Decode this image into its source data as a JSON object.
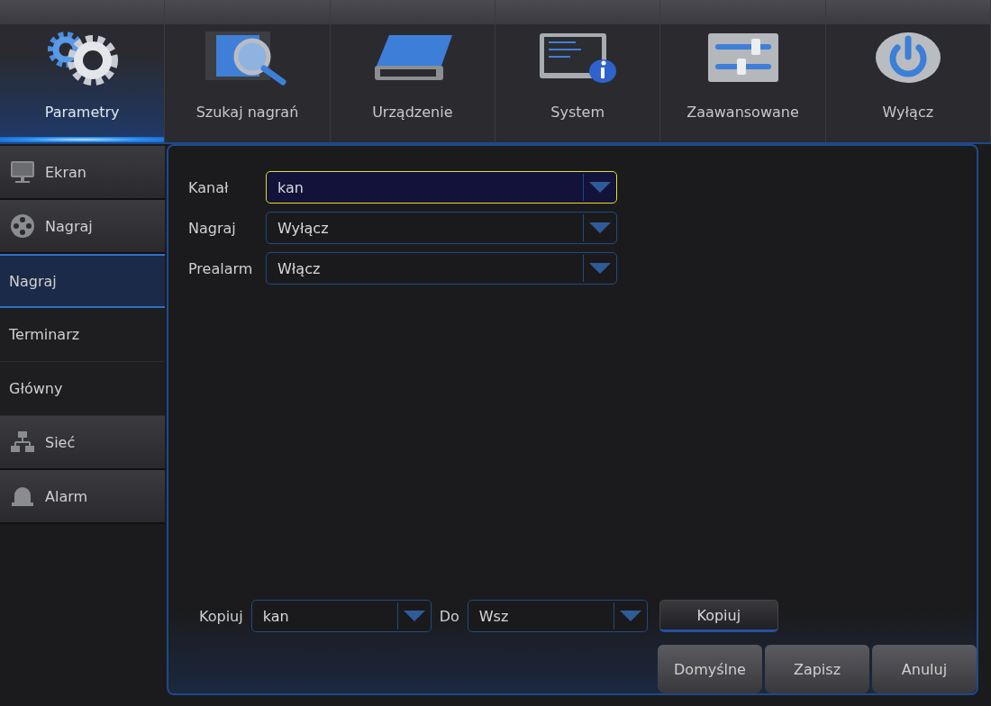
{
  "top_tabs": [
    {
      "label": "Parametry",
      "selected": true
    },
    {
      "label": "Szukaj nagrań",
      "selected": false
    },
    {
      "label": "Urządzenie",
      "selected": false
    },
    {
      "label": "System",
      "selected": false
    },
    {
      "label": "Zaawansowane",
      "selected": false
    },
    {
      "label": "Wyłącz",
      "selected": false
    }
  ],
  "sidebar": {
    "items": [
      {
        "label": "Ekran",
        "kind": "category",
        "selected": false
      },
      {
        "label": "Nagraj",
        "kind": "category",
        "selected": false
      },
      {
        "label": "Nagraj",
        "kind": "page",
        "selected": true
      },
      {
        "label": "Terminarz",
        "kind": "page",
        "selected": false
      },
      {
        "label": "Główny",
        "kind": "page",
        "selected": false
      },
      {
        "label": "Sieć",
        "kind": "category",
        "selected": false
      },
      {
        "label": "Alarm",
        "kind": "category",
        "selected": false
      }
    ]
  },
  "form": {
    "fields": [
      {
        "label": "Kanał",
        "value": "kan",
        "focused": true
      },
      {
        "label": "Nagraj",
        "value": "Wyłącz",
        "focused": false
      },
      {
        "label": "Prealarm",
        "value": "Włącz",
        "focused": false
      }
    ]
  },
  "copy_row": {
    "label": "Kopiuj",
    "from": "kan",
    "to_label": "Do",
    "to": "Wsz",
    "button": "Kopiuj"
  },
  "buttons": [
    "Domyślne",
    "Zapisz",
    "Anuluj"
  ]
}
